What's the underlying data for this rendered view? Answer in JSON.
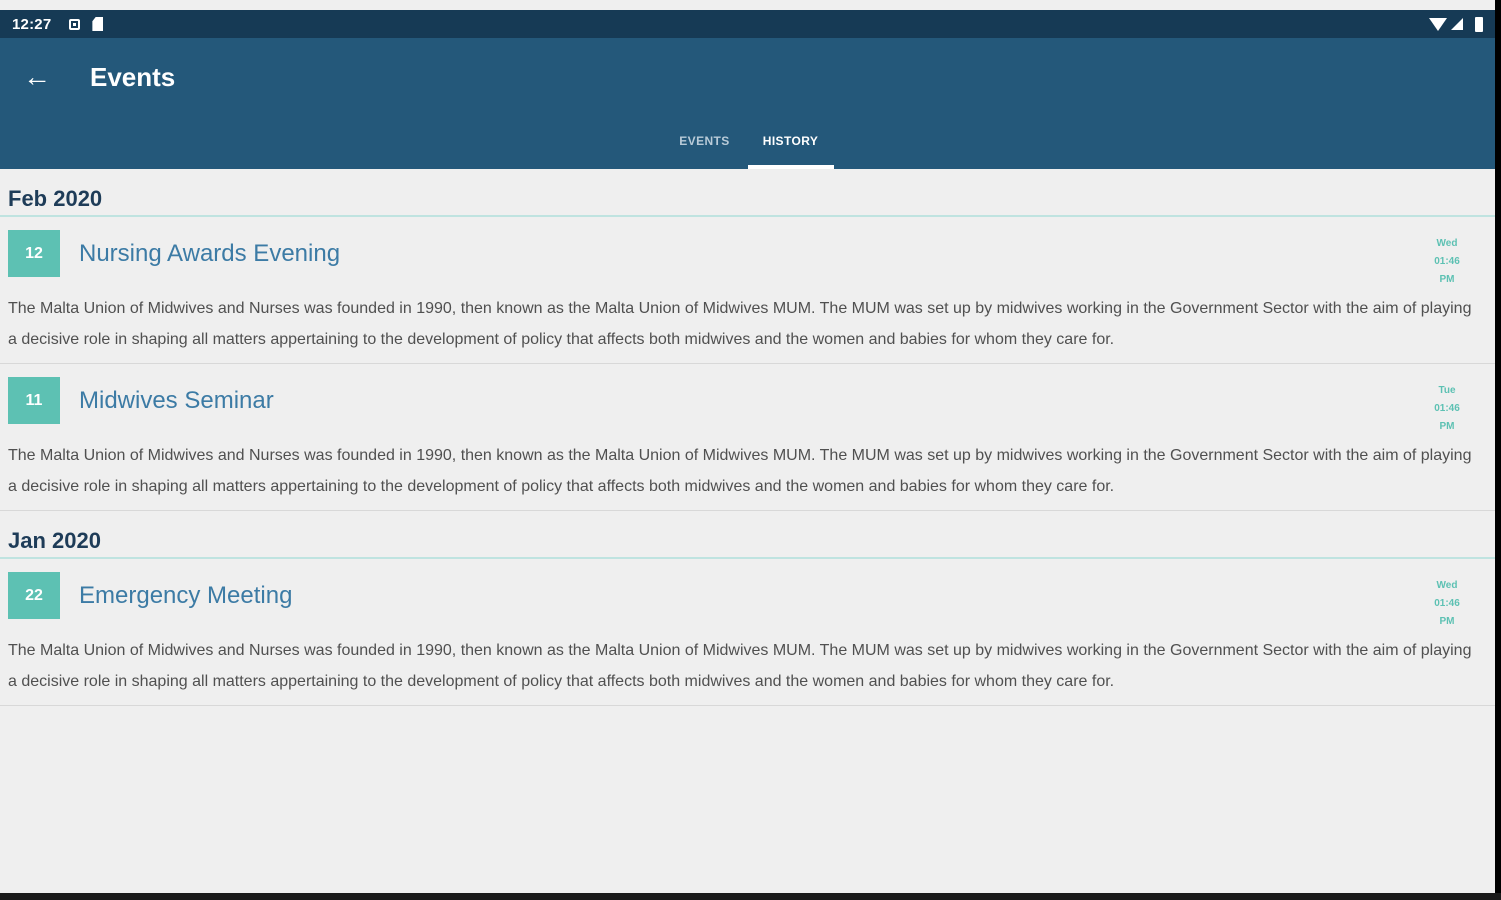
{
  "status_bar": {
    "time": "12:27"
  },
  "app_bar": {
    "title": "Events",
    "back_icon": "←"
  },
  "tabs": [
    {
      "label": "EVENTS",
      "active": false
    },
    {
      "label": "HISTORY",
      "active": true
    }
  ],
  "sections": [
    {
      "month": "Feb 2020",
      "events": [
        {
          "day": "12",
          "title": "Nursing Awards Evening",
          "weekday": "Wed",
          "time": "01:46",
          "ampm": "PM",
          "description": "The Malta Union of Midwives and Nurses was founded in 1990, then known as the Malta Union of Midwives MUM. The MUM was set up by midwives working in the Government Sector with the aim of playing a decisive role in shaping all matters appertaining to the development of policy that affects both midwives and the women and babies for whom they care for."
        },
        {
          "day": "11",
          "title": "Midwives Seminar",
          "weekday": "Tue",
          "time": "01:46",
          "ampm": "PM",
          "description": "The Malta Union of Midwives and Nurses was founded in 1990, then known as the Malta Union of Midwives MUM. The MUM was set up by midwives working in the Government Sector with the aim of playing a decisive role in shaping all matters appertaining to the development of policy that affects both midwives and the women and babies for whom they care for."
        }
      ]
    },
    {
      "month": "Jan 2020",
      "events": [
        {
          "day": "22",
          "title": "Emergency Meeting",
          "weekday": "Wed",
          "time": "01:46",
          "ampm": "PM",
          "description": "The Malta Union of Midwives and Nurses was founded in 1990, then known as the Malta Union of Midwives MUM. The MUM was set up by midwives working in the Government Sector with the aim of playing a decisive role in shaping all matters appertaining to the development of policy that affects both midwives and the women and babies for whom they care for."
        }
      ]
    }
  ],
  "colors": {
    "status_bar_bg": "#163a55",
    "app_bar_bg": "#24587a",
    "accent_teal": "#5dc1b3",
    "event_title": "#3c7ba5",
    "month_header": "#1e3c58"
  }
}
